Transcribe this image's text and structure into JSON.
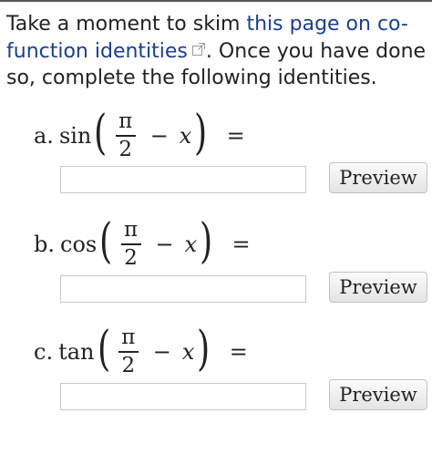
{
  "instructions": {
    "text_before": "Take a moment to skim ",
    "link_text": "this page on co-function identities",
    "text_after": ". Once you have done so, complete the following identities."
  },
  "problems": [
    {
      "letter": "a.",
      "fn": "sin",
      "numerator": "π",
      "denominator": "2",
      "minus": "−",
      "variable": "x",
      "equals": "=",
      "input_value": "",
      "preview_label": "Preview"
    },
    {
      "letter": "b.",
      "fn": "cos",
      "numerator": "π",
      "denominator": "2",
      "minus": "−",
      "variable": "x",
      "equals": "=",
      "input_value": "",
      "preview_label": "Preview"
    },
    {
      "letter": "c.",
      "fn": "tan",
      "numerator": "π",
      "denominator": "2",
      "minus": "−",
      "variable": "x",
      "equals": "=",
      "input_value": "",
      "preview_label": "Preview"
    }
  ],
  "colors": {
    "link": "#1a3f8f",
    "text": "#222222",
    "input_border": "#c9c9c9"
  },
  "icons": {
    "external_link": "external-link-icon"
  }
}
